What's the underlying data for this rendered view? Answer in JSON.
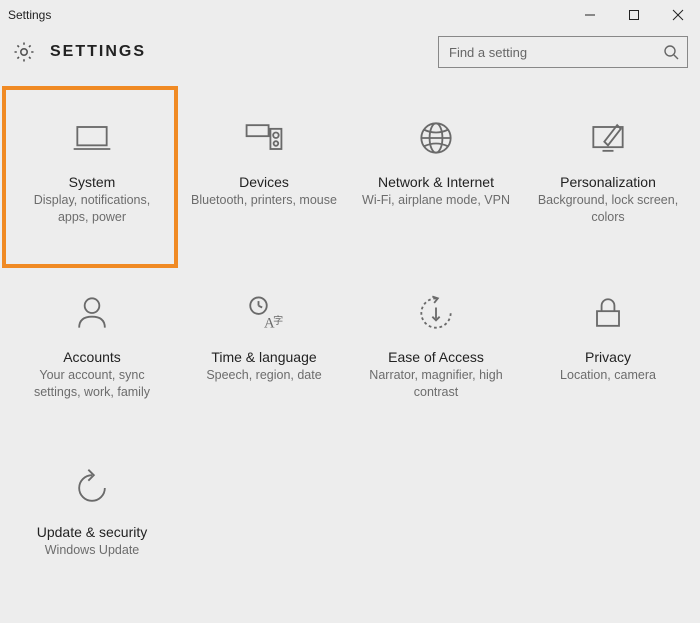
{
  "window": {
    "title": "Settings"
  },
  "header": {
    "label": "SETTINGS",
    "search_placeholder": "Find a setting"
  },
  "tiles": [
    {
      "id": "system",
      "title": "System",
      "desc": "Display, notifications, apps, power",
      "highlighted": true
    },
    {
      "id": "devices",
      "title": "Devices",
      "desc": "Bluetooth, printers, mouse",
      "highlighted": false
    },
    {
      "id": "network",
      "title": "Network & Internet",
      "desc": "Wi-Fi, airplane mode, VPN",
      "highlighted": false
    },
    {
      "id": "personalization",
      "title": "Personalization",
      "desc": "Background, lock screen, colors",
      "highlighted": false
    },
    {
      "id": "accounts",
      "title": "Accounts",
      "desc": "Your account, sync settings, work, family",
      "highlighted": false
    },
    {
      "id": "time",
      "title": "Time & language",
      "desc": "Speech, region, date",
      "highlighted": false
    },
    {
      "id": "ease",
      "title": "Ease of Access",
      "desc": "Narrator, magnifier, high contrast",
      "highlighted": false
    },
    {
      "id": "privacy",
      "title": "Privacy",
      "desc": "Location, camera",
      "highlighted": false
    },
    {
      "id": "update",
      "title": "Update & security",
      "desc": "Windows Update",
      "highlighted": false
    }
  ]
}
